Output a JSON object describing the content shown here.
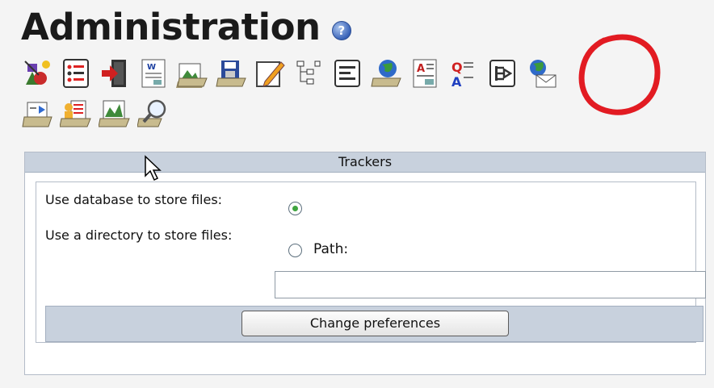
{
  "page": {
    "title": "Administration",
    "help_icon": "help-icon"
  },
  "toolbar": {
    "row1": [
      "general-settings-icon",
      "features-icon",
      "login-icon",
      "wiki-icon",
      "image-gallery-icon",
      "file-gallery-icon",
      "blogs-icon",
      "forums-icon",
      "faqs-icon",
      "map-icon",
      "articles-icon",
      "quiz-icon",
      "trackers-icon",
      "webmail-icon"
    ],
    "row2": [
      "directory-icon",
      "user-files-icon",
      "maps-icon",
      "search-icon"
    ]
  },
  "panel": {
    "heading": "Trackers",
    "db_label": "Use database to store files:",
    "dir_label": "Use a directory to store files:",
    "path_label": "Path:",
    "path_value": "",
    "db_checked": true,
    "dir_checked": false,
    "submit_label": "Change preferences"
  },
  "colors": {
    "panel_header_bg": "#c8d1dd",
    "radio_checked": "#3fa43f",
    "highlight": "#e21b22"
  }
}
